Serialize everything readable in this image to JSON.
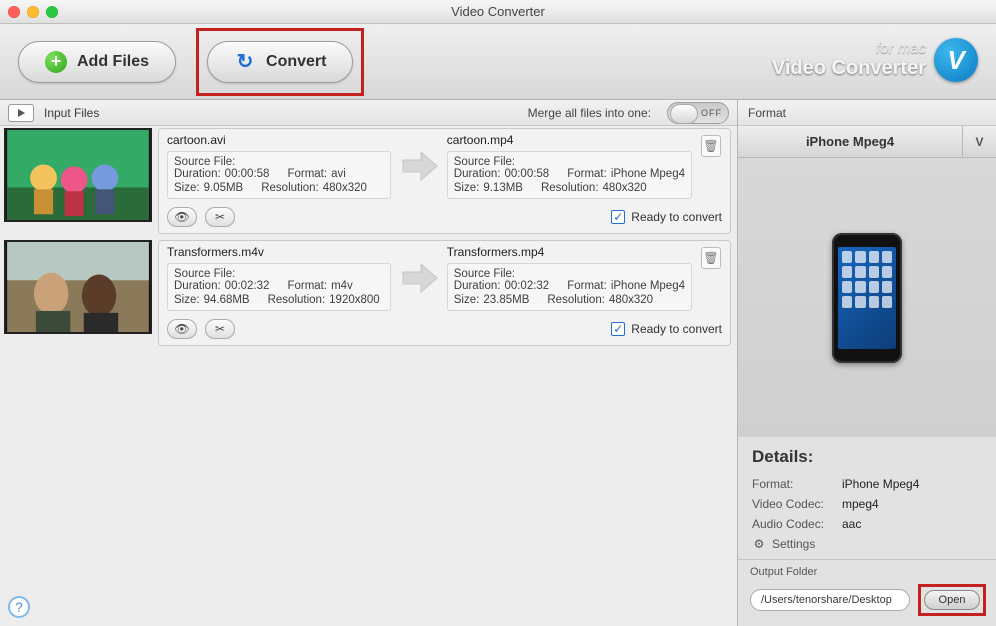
{
  "window": {
    "title": "Video Converter"
  },
  "toolbar": {
    "add_files_label": "Add Files",
    "convert_label": "Convert",
    "brand_line1": "for mac",
    "brand_line2": "Video Converter",
    "brand_logo_letter": "V"
  },
  "left_header": {
    "input_files_label": "Input Files",
    "merge_label": "Merge all files into one:",
    "switch_state": "OFF"
  },
  "files": [
    {
      "thumb_hint": "cartoon",
      "source": {
        "name": "cartoon.avi",
        "source_file_label": "Source File:",
        "duration_label": "Duration:",
        "duration": "00:00:58",
        "format_label": "Format:",
        "format": "avi",
        "size_label": "Size:",
        "size": "9.05MB",
        "resolution_label": "Resolution:",
        "resolution": "480x320"
      },
      "target": {
        "name": "cartoon.mp4",
        "source_file_label": "Source File:",
        "duration_label": "Duration:",
        "duration": "00:00:58",
        "format_label": "Format:",
        "format": "iPhone Mpeg4",
        "size_label": "Size:",
        "size": "9.13MB",
        "resolution_label": "Resolution:",
        "resolution": "480x320"
      },
      "ready_label": "Ready to convert",
      "ready_checked": true
    },
    {
      "thumb_hint": "transformers",
      "source": {
        "name": "Transformers.m4v",
        "source_file_label": "Source File:",
        "duration_label": "Duration:",
        "duration": "00:02:32",
        "format_label": "Format:",
        "format": "m4v",
        "size_label": "Size:",
        "size": "94.68MB",
        "resolution_label": "Resolution:",
        "resolution": "1920x800"
      },
      "target": {
        "name": "Transformers.mp4",
        "source_file_label": "Source File:",
        "duration_label": "Duration:",
        "duration": "00:02:32",
        "format_label": "Format:",
        "format": "iPhone Mpeg4",
        "size_label": "Size:",
        "size": "23.85MB",
        "resolution_label": "Resolution:",
        "resolution": "480x320"
      },
      "ready_label": "Ready to convert",
      "ready_checked": true
    }
  ],
  "right": {
    "format_header": "Format",
    "selected_format": "iPhone Mpeg4",
    "side_letter": "V",
    "details_title": "Details:",
    "detail_rows": {
      "format_k": "Format:",
      "format_v": "iPhone Mpeg4",
      "vcodec_k": "Video Codec:",
      "vcodec_v": "mpeg4",
      "acodec_k": "Audio Codec:",
      "acodec_v": "aac"
    },
    "settings_label": "Settings",
    "output_folder_label": "Output Folder",
    "output_path": "/Users/tenorshare/Desktop",
    "open_label": "Open"
  }
}
